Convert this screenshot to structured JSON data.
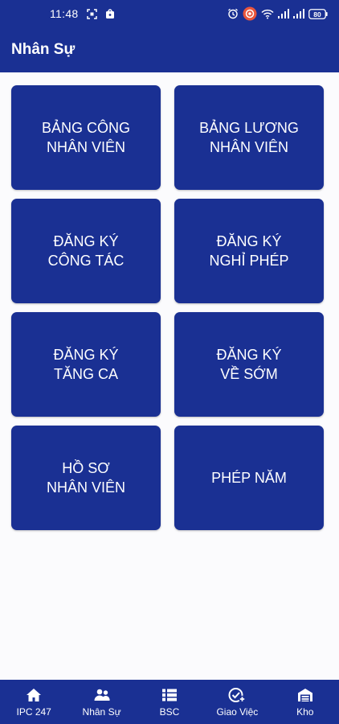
{
  "status_bar": {
    "time": "11:48",
    "battery": "80",
    "left_icons": [
      "screenshot-icon",
      "notification-bag-icon"
    ],
    "right_icons": [
      "alarm-icon",
      "record-icon",
      "wifi-icon",
      "signal-icon",
      "signal-icon",
      "battery-icon"
    ]
  },
  "app_bar": {
    "title": "Nhân Sự"
  },
  "tiles": [
    {
      "label": "BẢNG CÔNG\nNHÂN VIÊN"
    },
    {
      "label": "BẢNG LƯƠNG\nNHÂN VIÊN"
    },
    {
      "label": "ĐĂNG KÝ\nCÔNG TÁC"
    },
    {
      "label": "ĐĂNG KÝ\nNGHỈ PHÉP"
    },
    {
      "label": "ĐĂNG KÝ\nTĂNG CA"
    },
    {
      "label": "ĐĂNG KÝ\nVỀ SỚM"
    },
    {
      "label": "HỒ SƠ\nNHÂN VIÊN"
    },
    {
      "label": "PHÉP NĂM"
    }
  ],
  "bottom_nav": [
    {
      "label": "IPC 247",
      "icon": "home-icon"
    },
    {
      "label": "Nhân Sự",
      "icon": "people-icon"
    },
    {
      "label": "BSC",
      "icon": "list-icon"
    },
    {
      "label": "Giao Việc",
      "icon": "task-add-icon"
    },
    {
      "label": "Kho",
      "icon": "warehouse-icon"
    }
  ],
  "colors": {
    "primary": "#1a3093",
    "background": "#fbfbfd",
    "text_on_primary": "#ffffff",
    "record_badge": "#e8553d"
  }
}
